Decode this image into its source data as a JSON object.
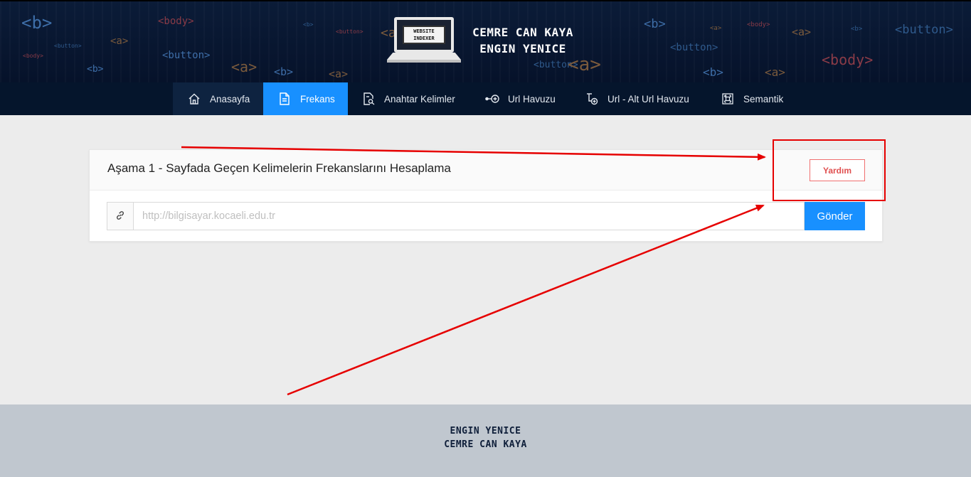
{
  "header": {
    "logo_text_line1": "WEBSITE",
    "logo_text_line2": "INDEXER",
    "brand_line1": "CEMRE CAN KAYA",
    "brand_line2": "ENGIN YENICE",
    "background_tags": [
      "<b>",
      "<body>",
      "<a>",
      "<button>",
      "<b>",
      "<body>",
      "<a>",
      "<button>",
      "<b>",
      "<a>",
      "<b>",
      "<button>",
      "<a>",
      "<b>",
      "<button>",
      "<a>",
      "<body>",
      "<b>",
      "<a>",
      "<body>",
      "<button>",
      "<a>",
      "<b>",
      "<a>",
      "<button>"
    ]
  },
  "nav": {
    "items": [
      {
        "label": "Anasayfa",
        "icon": "home-icon"
      },
      {
        "label": "Frekans",
        "icon": "file-text-icon",
        "active": true
      },
      {
        "label": "Anahtar Kelimler",
        "icon": "file-search-icon"
      },
      {
        "label": "Url Havuzu",
        "icon": "plus-circle-connector-icon"
      },
      {
        "label": "Url - Alt Url Havuzu",
        "icon": "branch-plus-icon"
      },
      {
        "label": "Semantik",
        "icon": "command-icon"
      }
    ]
  },
  "card": {
    "title": "Aşama 1 - Sayfada Geçen Kelimelerin Frekanslarını Hesaplama",
    "help_label": "Yardım",
    "url_placeholder": "http://bilgisayar.kocaeli.edu.tr",
    "url_value": "",
    "send_label": "Gönder"
  },
  "footer": {
    "line1": "ENGIN YENICE",
    "line2": "CEMRE CAN KAYA"
  },
  "colors": {
    "accent": "#1890ff",
    "header_bg": "#0a1a33",
    "nav_bg": "#05152c",
    "help_red": "#e05050",
    "annotation_red": "#e60000",
    "footer_bg": "#c0c7cf"
  }
}
